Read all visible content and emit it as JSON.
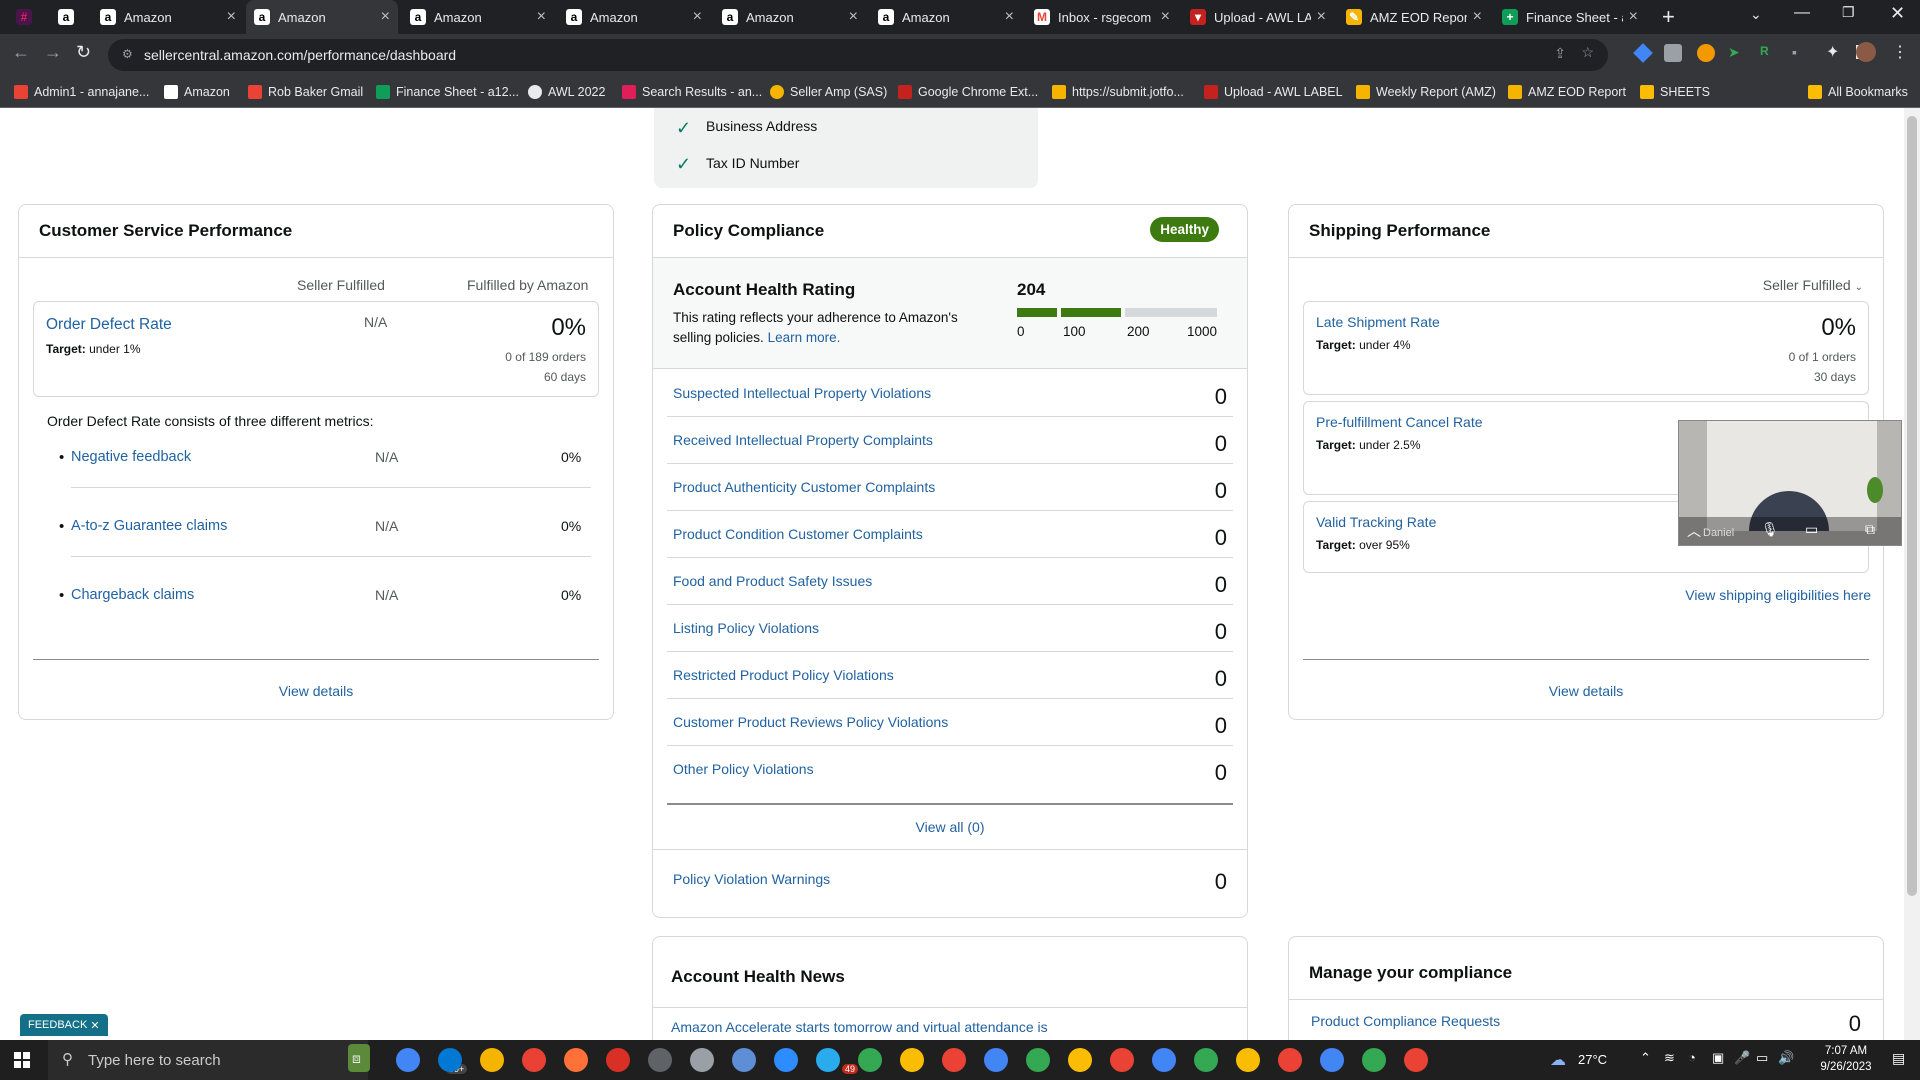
{
  "browser": {
    "tabs": [
      {
        "title": "",
        "icon": "slack-icon",
        "color": "#4a154b"
      },
      {
        "title": "",
        "icon": "amazon-icon",
        "color": "#ffffff"
      },
      {
        "title": "Amazon",
        "icon": "amazon-icon",
        "color": "#ffffff"
      },
      {
        "title": "Amazon",
        "icon": "amazon-icon",
        "color": "#ffffff"
      },
      {
        "title": "Amazon",
        "icon": "amazon-icon",
        "color": "#ffffff"
      },
      {
        "title": "Amazon",
        "icon": "amazon-icon",
        "color": "#ffffff"
      },
      {
        "title": "Amazon",
        "icon": "amazon-icon",
        "color": "#ffffff"
      },
      {
        "title": "Amazon",
        "icon": "amazon-icon",
        "color": "#ffffff"
      },
      {
        "title": "Inbox - rsgecom",
        "icon": "gmail-icon",
        "color": "#ea4335"
      },
      {
        "title": "Upload - AWL LA",
        "icon": "upload-icon",
        "color": "#c5221f"
      },
      {
        "title": "AMZ EOD Report",
        "icon": "report-icon",
        "color": "#f4b400"
      },
      {
        "title": "Finance Sheet - a",
        "icon": "sheets-icon",
        "color": "#0f9d58"
      }
    ],
    "url": "sellercentral.amazon.com/performance/dashboard",
    "bookmarks": [
      {
        "label": "Admin1 - annajane...",
        "color": "#ea4335"
      },
      {
        "label": "Amazon",
        "color": "#ffffff"
      },
      {
        "label": "Rob Baker Gmail",
        "color": "#ea4335"
      },
      {
        "label": "Finance Sheet - a12...",
        "color": "#0f9d58"
      },
      {
        "label": "AWL 2022",
        "color": "#e8eaed"
      },
      {
        "label": "Search Results - an...",
        "color": "#e01e5a"
      },
      {
        "label": "Seller Amp (SAS)",
        "color": "#f4b400"
      },
      {
        "label": "Google Chrome Ext...",
        "color": "#c5221f"
      },
      {
        "label": "https://submit.jotfo...",
        "color": "#f4b400"
      },
      {
        "label": "Upload - AWL LABEL",
        "color": "#c5221f"
      },
      {
        "label": "Weekly Report (AMZ)",
        "color": "#f4b400"
      },
      {
        "label": "AMZ EOD Report",
        "color": "#f4b400"
      },
      {
        "label": "SHEETS",
        "color": "#fbbc04"
      }
    ],
    "all_bookmarks": "All Bookmarks"
  },
  "top_box": {
    "items": [
      "Business Address",
      "Tax ID Number"
    ]
  },
  "customer_service": {
    "title": "Customer Service Performance",
    "col_seller": "Seller Fulfilled",
    "col_fba": "Fulfilled by Amazon",
    "odr_label": "Order Defect Rate",
    "odr_target_prefix": "Target:",
    "odr_target": "under 1%",
    "odr_seller": "N/A",
    "odr_fba": "0%",
    "odr_orders": "0 of 189 orders",
    "odr_days": "60 days",
    "consists": "Order Defect Rate consists of three different metrics:",
    "metrics": [
      {
        "label": "Negative feedback",
        "seller": "N/A",
        "fba": "0%"
      },
      {
        "label": "A-to-z Guarantee claims",
        "seller": "N/A",
        "fba": "0%"
      },
      {
        "label": "Chargeback claims",
        "seller": "N/A",
        "fba": "0%"
      }
    ],
    "view_details": "View details"
  },
  "policy": {
    "title": "Policy Compliance",
    "badge": "Healthy",
    "badge_color": "#3d7a0f",
    "ahr_title": "Account Health Rating",
    "ahr_desc1": "This rating reflects your adherence to Amazon's",
    "ahr_desc2": "selling policies.",
    "learn_more": "Learn more.",
    "ahr_value": "204",
    "scale": [
      "0",
      "100",
      "200",
      "1000"
    ],
    "rows": [
      {
        "label": "Suspected Intellectual Property Violations",
        "value": "0"
      },
      {
        "label": "Received Intellectual Property Complaints",
        "value": "0"
      },
      {
        "label": "Product Authenticity Customer Complaints",
        "value": "0"
      },
      {
        "label": "Product Condition Customer Complaints",
        "value": "0"
      },
      {
        "label": "Food and Product Safety Issues",
        "value": "0"
      },
      {
        "label": "Listing Policy Violations",
        "value": "0"
      },
      {
        "label": "Restricted Product Policy Violations",
        "value": "0"
      },
      {
        "label": "Customer Product Reviews Policy Violations",
        "value": "0"
      },
      {
        "label": "Other Policy Violations",
        "value": "0"
      }
    ],
    "view_all": "View all (0)",
    "warnings_label": "Policy Violation Warnings",
    "warnings_value": "0"
  },
  "shipping": {
    "title": "Shipping Performance",
    "dropdown": "Seller Fulfilled",
    "late_label": "Late Shipment Rate",
    "late_target": "under 4%",
    "late_value": "0%",
    "late_orders": "0 of 1 orders",
    "late_days": "30 days",
    "cancel_label": "Pre-fulfillment Cancel Rate",
    "cancel_target": "under 2.5%",
    "tracking_label": "Valid Tracking Rate",
    "tracking_target": "over 95%",
    "eligibilities": "View shipping eligibilities here",
    "view_details": "View details",
    "video_name": "Daniel"
  },
  "news": {
    "title": "Account Health News",
    "item": "Amazon Accelerate starts tomorrow and virtual attendance is"
  },
  "compliance": {
    "title": "Manage your compliance",
    "row_label": "Product Compliance Requests",
    "row_value": "0"
  },
  "feedback": "FEEDBACK",
  "taskbar": {
    "search": "Type here to search",
    "weather": "27°C",
    "time": "7:07 AM",
    "date": "9/26/2023",
    "badge_mail": "99+",
    "badge_one": "49"
  }
}
